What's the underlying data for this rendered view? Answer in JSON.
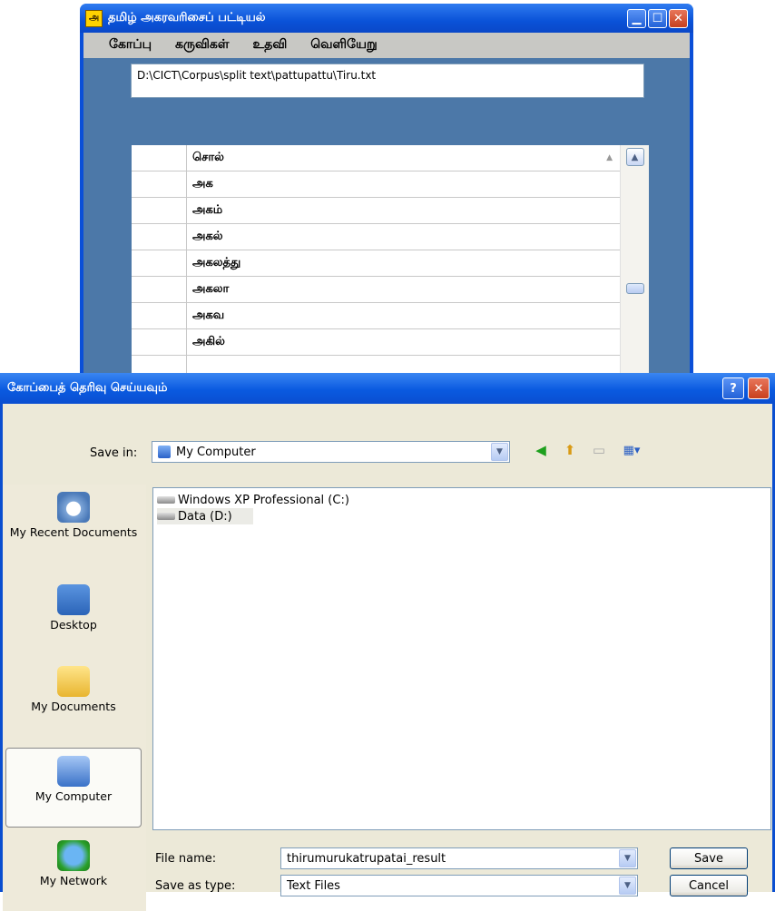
{
  "app": {
    "icon_glyph": "அ",
    "title": "தமிழ் அகரவரிசைப் பட்டியல்",
    "menu": [
      "கோப்பு",
      "கருவிகள்",
      "உதவி",
      "வெளியேறு"
    ],
    "file_path": "D:\\CICT\\Corpus\\split text\\pattupattu\\Tiru.txt",
    "grid": {
      "column_header": "சொல்",
      "rows": [
        "அக",
        "அகம்",
        "அகல்",
        "அகலத்து",
        "அகலா",
        "அகவ",
        "அகில்",
        ""
      ]
    }
  },
  "dialog": {
    "title": "கோப்பைத் தெரிவு செய்யவும்",
    "help_glyph": "?",
    "close_glyph": "✕",
    "save_in_label": "Save in:",
    "save_in_value": "My Computer",
    "places": [
      "My Recent Documents",
      "Desktop",
      "My Documents",
      "My Computer",
      "My Network"
    ],
    "files": [
      "Windows XP Professional (C:)",
      "Data (D:)"
    ],
    "file_name_label": "File name:",
    "file_name_value": "thirumurukatrupatai_result",
    "save_as_type_label": "Save as type:",
    "save_as_type_value": "Text Files",
    "save_button": "Save",
    "cancel_button": "Cancel"
  }
}
